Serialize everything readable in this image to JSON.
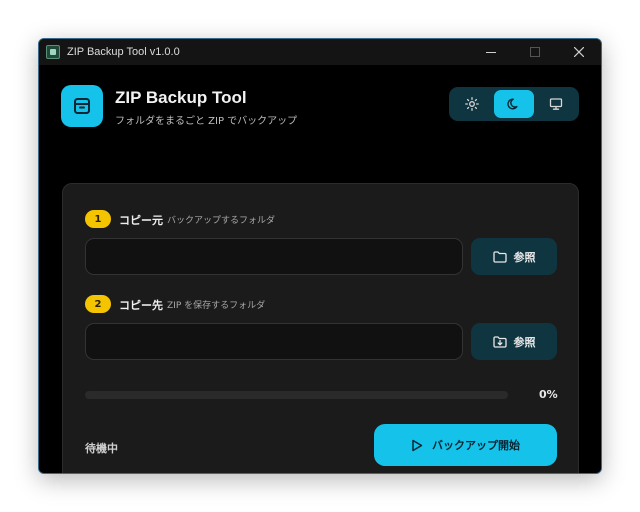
{
  "window": {
    "title": "ZIP Backup Tool v1.0.0",
    "minimize_icon": "minimize-icon",
    "maximize_icon": "maximize-icon",
    "close_icon": "close-icon"
  },
  "header": {
    "app_name": "ZIP Backup Tool",
    "subtitle": "フォルダをまるごと ZIP でバックアップ",
    "logo_icon": "archive-icon"
  },
  "theme": {
    "options": [
      {
        "icon": "sun-icon",
        "active": false
      },
      {
        "icon": "moon-icon",
        "active": true
      },
      {
        "icon": "monitor-icon",
        "active": false
      }
    ]
  },
  "source": {
    "step": "1",
    "label": "コピー元",
    "hint": "バックアップするフォルダ",
    "value": "",
    "browse_label": "参照",
    "browse_icon": "folder-icon"
  },
  "destination": {
    "step": "2",
    "label": "コピー先",
    "hint": "ZIP を保存するフォルダ",
    "value": "",
    "browse_label": "参照",
    "browse_icon": "folder-download-icon"
  },
  "progress": {
    "value": 0,
    "text": "0%"
  },
  "status": {
    "text": "待機中"
  },
  "start_button": {
    "label": "バックアップ開始",
    "icon": "play-icon"
  },
  "colors": {
    "accent": "#15c2ea",
    "step_badge": "#f5c400",
    "panel": "#1b1b1b",
    "button_dark": "#0f3540"
  }
}
